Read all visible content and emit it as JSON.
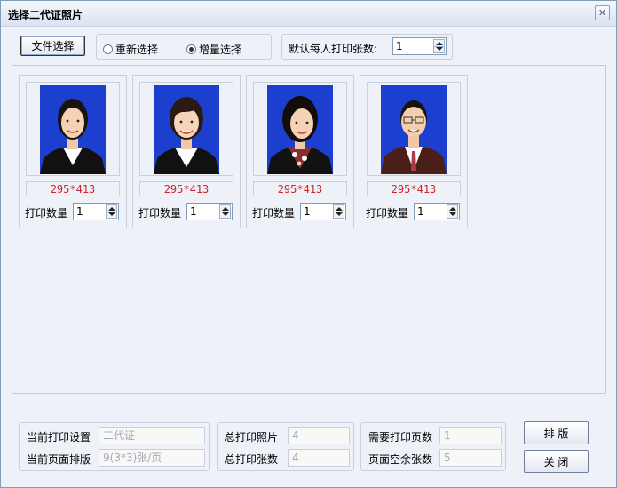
{
  "window": {
    "title": "选择二代证照片",
    "close_glyph": "✕"
  },
  "toolbar": {
    "file_select_label": "文件选择",
    "radio_reselect_label": "重新选择",
    "radio_incremental_label": "增量选择",
    "selected_mode": "增量选择",
    "default_per_person_label": "默认每人打印张数:",
    "default_per_person_value": "1"
  },
  "photos": [
    {
      "size": "295*413",
      "qty_label": "打印数量",
      "qty": "1",
      "shirt": "#ffffff",
      "jacket": "#111111"
    },
    {
      "size": "295*413",
      "qty_label": "打印数量",
      "qty": "1",
      "shirt": "#ffffff",
      "jacket": "#111111"
    },
    {
      "size": "295*413",
      "qty_label": "打印数量",
      "qty": "1",
      "shirt": "#8b2d2d",
      "jacket": "#111111"
    },
    {
      "size": "295*413",
      "qty_label": "打印数量",
      "qty": "1",
      "shirt": "#ffffff",
      "jacket": "#4a1f1a"
    }
  ],
  "footer": {
    "current_print_setting_label": "当前打印设置",
    "current_print_setting_value": "二代证",
    "current_layout_label": "当前页面排版",
    "current_layout_value": "9(3*3)张/页",
    "total_photos_label": "总打印照片",
    "total_photos_value": "4",
    "total_sheets_label": "总打印张数",
    "total_sheets_value": "4",
    "pages_needed_label": "需要打印页数",
    "pages_needed_value": "1",
    "empty_slots_label": "页面空余张数",
    "empty_slots_value": "5",
    "layout_button": "排 版",
    "close_button": "关 闭"
  },
  "colors": {
    "photo_bg": "#1d3fd0",
    "size_text": "#d0232a"
  }
}
